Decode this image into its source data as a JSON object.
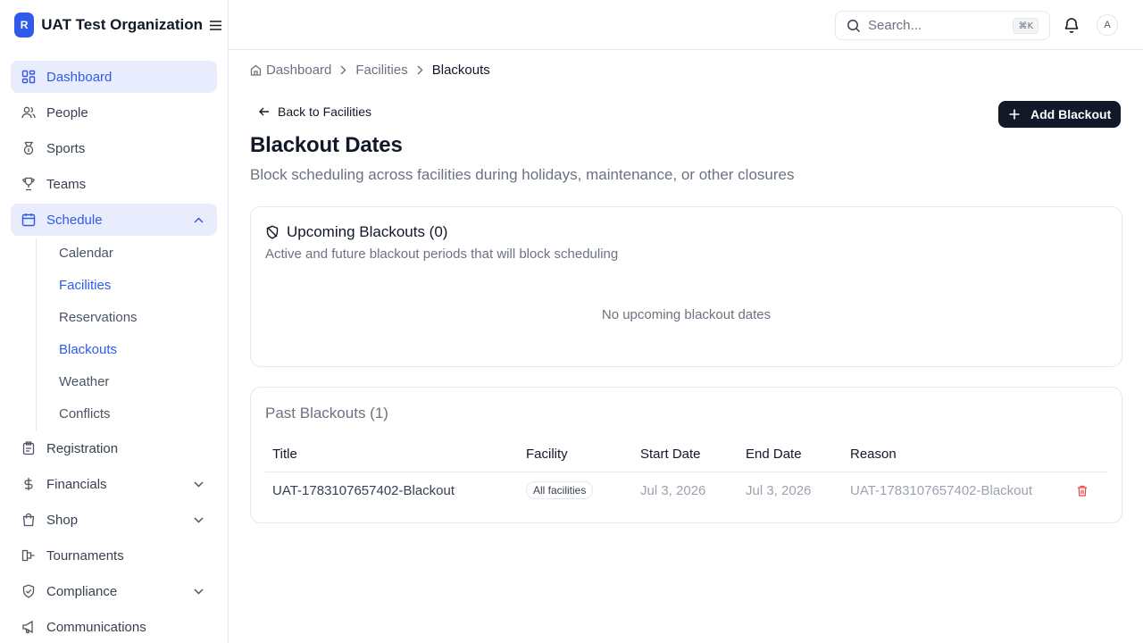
{
  "org": {
    "logo_letter": "R",
    "name": "UAT Test Organization"
  },
  "sidebar": {
    "items": [
      {
        "label": "Dashboard"
      },
      {
        "label": "People"
      },
      {
        "label": "Sports"
      },
      {
        "label": "Teams"
      },
      {
        "label": "Schedule"
      },
      {
        "label": "Registration"
      },
      {
        "label": "Financials"
      },
      {
        "label": "Shop"
      },
      {
        "label": "Tournaments"
      },
      {
        "label": "Compliance"
      },
      {
        "label": "Communications"
      }
    ],
    "schedule_sub": [
      {
        "label": "Calendar"
      },
      {
        "label": "Facilities"
      },
      {
        "label": "Reservations"
      },
      {
        "label": "Blackouts"
      },
      {
        "label": "Weather"
      },
      {
        "label": "Conflicts"
      }
    ]
  },
  "header": {
    "search_placeholder": "Search...",
    "shortcut": "⌘K",
    "avatar_initial": "A"
  },
  "breadcrumb": [
    "Dashboard",
    "Facilities",
    "Blackouts"
  ],
  "page": {
    "back_label": "Back to Facilities",
    "add_button": "Add Blackout",
    "title": "Blackout Dates",
    "subtitle": "Block scheduling across facilities during holidays, maintenance, or other closures"
  },
  "upcoming": {
    "title": "Upcoming Blackouts (0)",
    "description": "Active and future blackout periods that will block scheduling",
    "empty_message": "No upcoming blackout dates"
  },
  "past": {
    "title": "Past Blackouts (1)",
    "columns": [
      "Title",
      "Facility",
      "Start Date",
      "End Date",
      "Reason"
    ],
    "rows": [
      {
        "title": "UAT-1783107657402-Blackout",
        "facility": "All facilities",
        "start": "Jul 3, 2026",
        "end": "Jul 3, 2026",
        "reason": "UAT-1783107657402-Blackout"
      }
    ]
  },
  "colors": {
    "accent": "#2f5bea",
    "active_bg": "#e8ecfd",
    "primary_button": "#111827",
    "danger": "#ef4444"
  },
  "icons": [
    "menu-icon",
    "dashboard-icon",
    "people-icon",
    "sports-icon",
    "teams-icon",
    "calendar-icon",
    "chevron-up-icon",
    "registration-icon",
    "dollar-icon",
    "chevron-down-icon",
    "shop-icon",
    "tournaments-icon",
    "compliance-icon",
    "megaphone-icon",
    "search-icon",
    "bell-icon",
    "home-icon",
    "chevron-right-icon",
    "arrow-left-icon",
    "plus-icon",
    "shield-off-icon",
    "trash-icon"
  ]
}
